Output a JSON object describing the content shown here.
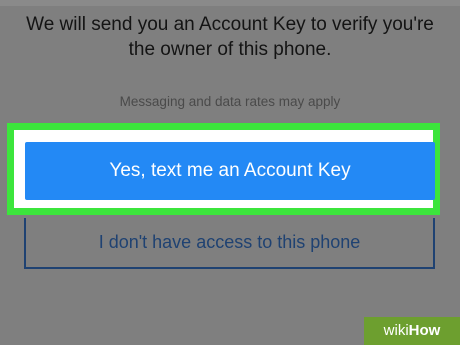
{
  "verification": {
    "message": "We will send you an Account Key to verify you're the owner of this phone.",
    "disclaimer": "Messaging and data rates may apply",
    "primary_button_label": "Yes, text me an Account Key",
    "secondary_button_label": "I don't have access to this phone"
  },
  "colors": {
    "background": "#7f7f7f",
    "primary_button": "#2389f5",
    "highlight": "#3ce53c",
    "secondary_text": "#1f4272"
  },
  "watermark": {
    "part1": "wiki",
    "part2": "How"
  }
}
